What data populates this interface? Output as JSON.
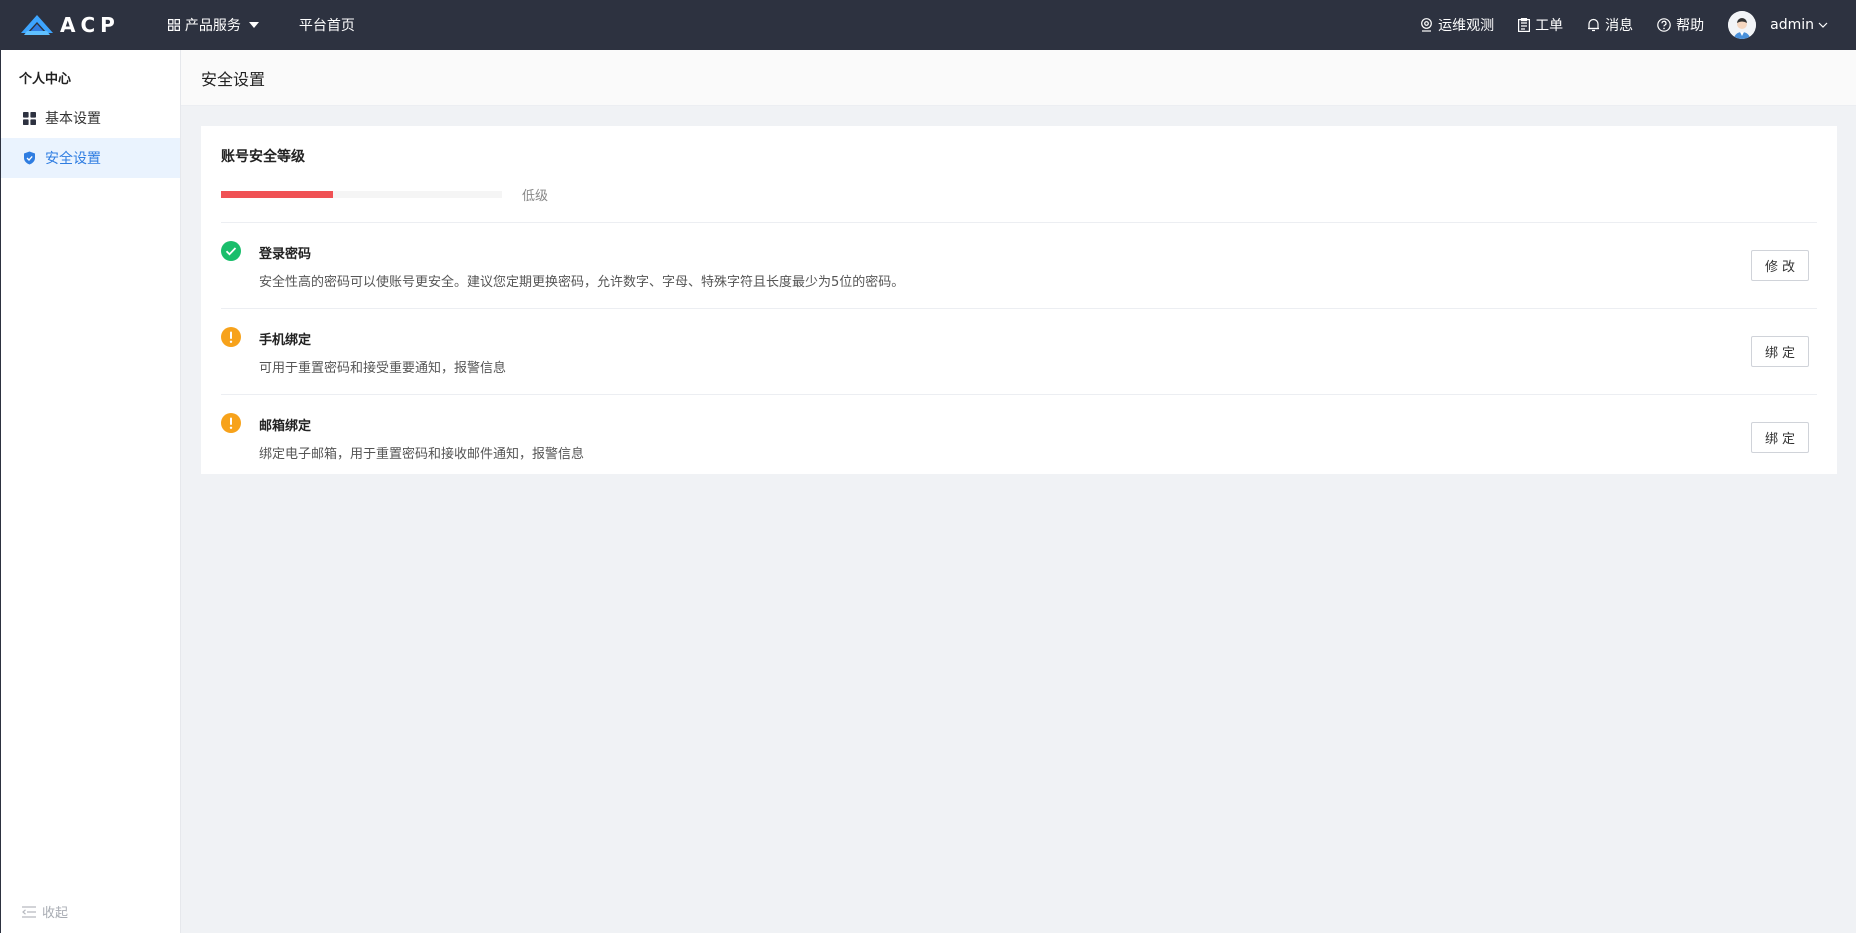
{
  "topbar": {
    "logo_text": "ACP",
    "nav": [
      {
        "label": "产品服务",
        "icon": "grid-icon"
      },
      {
        "label": "平台首页"
      }
    ],
    "right": [
      {
        "label": "运维观测",
        "icon": "location-icon"
      },
      {
        "label": "工单",
        "icon": "clipboard-icon"
      },
      {
        "label": "消息",
        "icon": "bell-icon"
      },
      {
        "label": "帮助",
        "icon": "help-icon"
      }
    ],
    "user": "admin"
  },
  "sidebar": {
    "title": "个人中心",
    "items": [
      {
        "label": "基本设置",
        "icon": "dashboard-icon",
        "active": false
      },
      {
        "label": "安全设置",
        "icon": "shield-icon",
        "active": true
      }
    ],
    "collapse_label": "收起"
  },
  "page": {
    "title": "安全设置"
  },
  "security": {
    "title": "账号安全等级",
    "level_label": "低级",
    "level_fraction": 0.4,
    "colors": {
      "level_bar": "#f05154",
      "ok": "#19be6b",
      "warn": "#f7a21b"
    },
    "items": [
      {
        "title": "登录密码",
        "desc": "安全性高的密码可以使账号更安全。建议您定期更换密码，允许数字、字母、特殊字符且长度最少为5位的密码。",
        "status": "ok",
        "button": "修改"
      },
      {
        "title": "手机绑定",
        "desc": "可用于重置密码和接受重要通知，报警信息",
        "status": "warn",
        "button": "绑定"
      },
      {
        "title": "邮箱绑定",
        "desc": "绑定电子邮箱，用于重置密码和接收邮件通知，报警信息",
        "status": "warn",
        "button": "绑定"
      }
    ]
  }
}
